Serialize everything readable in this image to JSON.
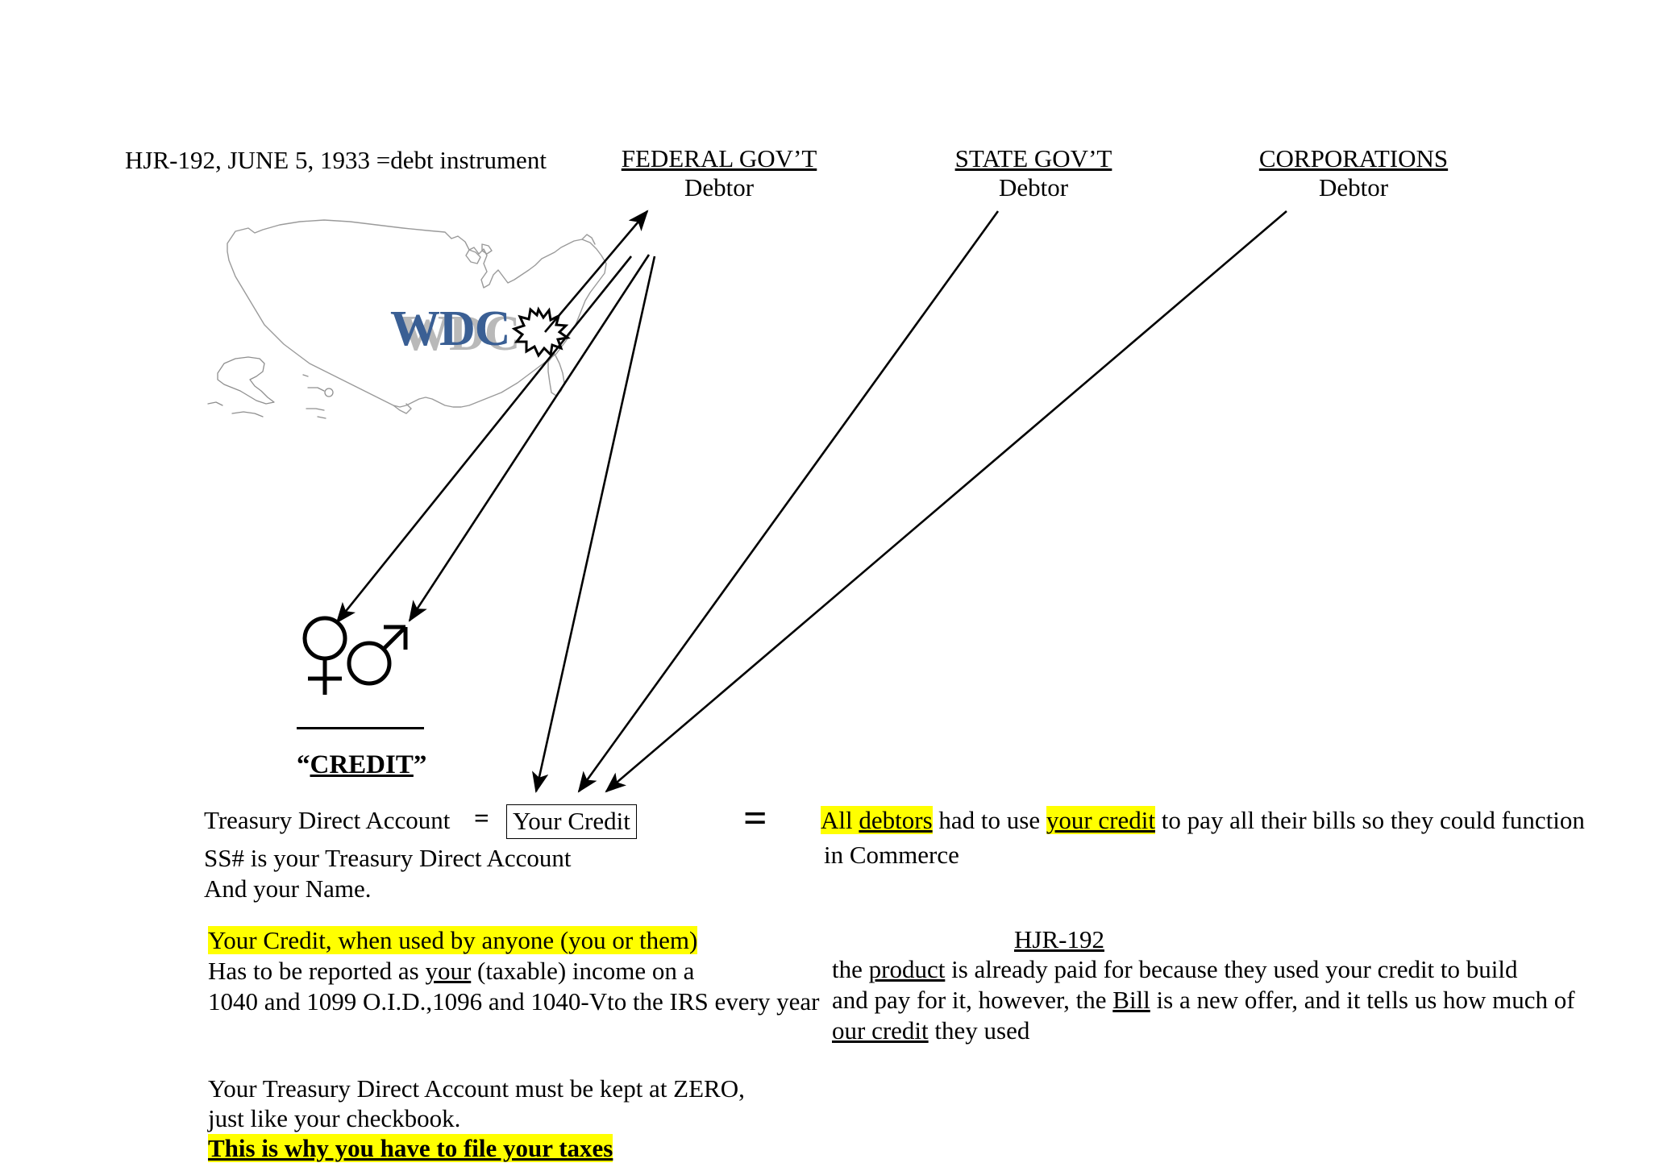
{
  "header": {
    "hjr_title": "HJR-192, JUNE 5, 1933 =debt instrument",
    "orgs": [
      {
        "name": "FEDERAL GOV’T",
        "role": "Debtor"
      },
      {
        "name": "STATE GOV’T",
        "role": "Debtor"
      },
      {
        "name": "CORPORATIONS",
        "role": "Debtor"
      }
    ]
  },
  "map": {
    "logo_text": "WDC",
    "logo_color": "#3a5f94",
    "logo_shadow_color": "#b9b9b9",
    "burst_name": "starburst"
  },
  "people": {
    "female_symbol": "female-symbol",
    "male_symbol": "male-symbol",
    "credit_label_open_quote": "“",
    "credit_label_text": "CREDIT",
    "credit_label_close_quote": "”"
  },
  "equation": {
    "tda_label": "Treasury Direct Account",
    "equals_small": "=",
    "your_credit_box": "Your Credit",
    "equals_large": "=",
    "tda_sub_line1": "SS# is your Treasury Direct Account",
    "tda_sub_line2": "And your Name."
  },
  "debtors": {
    "hl_part1": "All debtors",
    "hl_part1_underlined": "debtors",
    "mid": " had to use ",
    "hl_part2": "your credit",
    "tail": " to pay all their bills so they could function",
    "line2": "in Commerce"
  },
  "credit_use": {
    "line1_highlighted": "Your Credit, when used by anyone (you or them)",
    "line2_a": "Has to be reported as ",
    "line2_underlined": "your",
    "line2_b": " (taxable) income on a",
    "line3": "1040 and 1099 O.I.D.,1096 and 1040-Vto the IRS every year"
  },
  "hjr192": {
    "heading": "HJR-192",
    "line1_a": "the ",
    "line1_underlined": "product",
    "line1_b": " is already paid for because they used your credit to build",
    "line2_a": "and pay for it, however, the ",
    "line2_underlined": "Bill",
    "line2_b": " is a new offer, and it tells us how much of",
    "line3_underlined": "our credit",
    "line3_b": " they used"
  },
  "zero_account": {
    "line1": "Your Treasury Direct Account must be kept at ZERO,",
    "line2": "just like your checkbook.",
    "line3_highlighted": "This is why you have to file your taxes"
  },
  "colors": {
    "highlight": "#ffff00",
    "ink": "#000000",
    "map_outline": "#9a9a9a"
  }
}
